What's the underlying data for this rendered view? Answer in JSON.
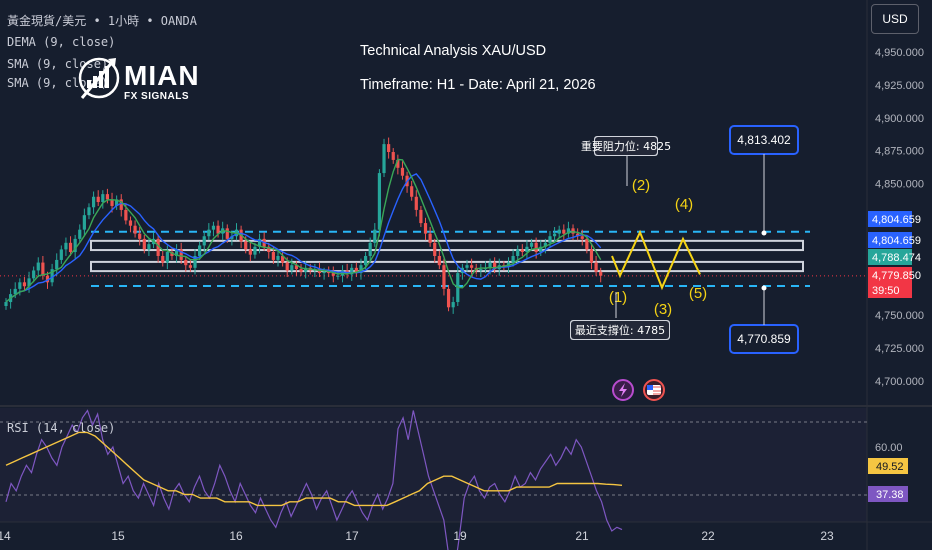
{
  "legend": {
    "symbol_line": "黃金現貨/美元 • 1小時 • OANDA",
    "indicator_1": "DEMA (9, close)",
    "indicator_2": "SMA (9, close)",
    "indicator_3": "SMA (9, close)",
    "rsi_label": "RSI (14, close)"
  },
  "logo": {
    "title": "MIAN",
    "subtitle": "FX SIGNALS"
  },
  "header": {
    "title": "Technical Analysis XAU/USD",
    "subtitle": "Timeframe: H1 - Date: April 21, 2026"
  },
  "price_axis": {
    "currency": "USD",
    "ticks": [
      "4,950.000",
      "4,925.000",
      "4,900.000",
      "4,875.000",
      "4,850.000",
      "4,750.000",
      "4,725.000",
      "4,700.000"
    ],
    "tick_values": [
      4950,
      4925,
      4900,
      4875,
      4850,
      4750,
      4725,
      4700
    ],
    "badges": [
      {
        "text": "4,804.659",
        "value": 4804.659,
        "color": "#2962ff"
      },
      {
        "text": "4,804.659",
        "value": 4804.659,
        "color": "#2962ff"
      },
      {
        "text": "4,788.474",
        "value": 4788.474,
        "color": "#26a69a"
      },
      {
        "text": "4,779.850",
        "value": 4779.85,
        "color": "#f23645"
      },
      {
        "text": "39:50",
        "value": null,
        "color": "#f23645"
      }
    ]
  },
  "rsi_axis": {
    "ticks": [
      "60.00"
    ],
    "badges": [
      {
        "text": "49.52",
        "value": 49.52,
        "color": "#f5c542"
      },
      {
        "text": "37.38",
        "value": 37.38,
        "color": "#7e57c2"
      }
    ]
  },
  "time_axis": {
    "labels": [
      "14",
      "15",
      "16",
      "17",
      "19",
      "21",
      "22",
      "23"
    ]
  },
  "annotations": {
    "resistance": {
      "text": "4,813.402",
      "value": 4813.402
    },
    "support": {
      "text": "4,770.859",
      "value": 4770.859
    },
    "resistance_note": "重要阻力位: 4825",
    "support_note": "最近支撐位: 4785",
    "wave_labels": [
      "(1)",
      "(2)",
      "(3)",
      "(4)",
      "(5)"
    ]
  },
  "colors": {
    "background": "#161e2e",
    "bull": "#26a69a",
    "bear": "#ef5350",
    "dema": "#3aa757",
    "sma_blue": "#2962ff",
    "wave": "#f5d315",
    "level_dash": "#29b6f6",
    "rsi": "#7e57c2",
    "rsi_ma": "#f5c542"
  },
  "chart_data": {
    "type": "candlestick",
    "title": "Technical Analysis XAU/USD",
    "subtitle": "Timeframe: H1 - Date: April 21, 2026",
    "xlabel": "",
    "ylabel": "",
    "ylim": [
      4690,
      4965
    ],
    "x_tick_labels": [
      "14",
      "15",
      "16",
      "17",
      "19",
      "21",
      "22",
      "23"
    ],
    "y_tick_labels": [
      "4,950.000",
      "4,925.000",
      "4,900.000",
      "4,875.000",
      "4,850.000",
      "4,750.000",
      "4,725.000",
      "4,700.000"
    ],
    "resistance_levels": [
      4813.402,
      4804.659
    ],
    "support_levels": [
      4788.474,
      4770.859
    ],
    "wave_projection": [
      {
        "label": "(1)",
        "price": 4780
      },
      {
        "label": "(2)",
        "price": 4813
      },
      {
        "label": "(3)",
        "price": 4771
      },
      {
        "label": "(4)",
        "price": 4808
      },
      {
        "label": "(5)",
        "price": 4781
      }
    ],
    "close_series": [
      4760,
      4766,
      4770,
      4775,
      4772,
      4778,
      4784,
      4790,
      4780,
      4775,
      4785,
      4792,
      4800,
      4805,
      4798,
      4808,
      4815,
      4826,
      4832,
      4840,
      4836,
      4842,
      4838,
      4833,
      4838,
      4830,
      4822,
      4818,
      4812,
      4808,
      4800,
      4804,
      4808,
      4795,
      4790,
      4798,
      4795,
      4800,
      4792,
      4788,
      4786,
      4795,
      4803,
      4810,
      4815,
      4818,
      4812,
      4816,
      4808,
      4810,
      4815,
      4806,
      4800,
      4796,
      4802,
      4808,
      4802,
      4798,
      4792,
      4795,
      4790,
      4784,
      4788,
      4785,
      4783,
      4786,
      4784,
      4785,
      4782,
      4783,
      4782,
      4780,
      4780,
      4784,
      4781,
      4786,
      4782,
      4788,
      4795,
      4805,
      4815,
      4858,
      4880,
      4874,
      4868,
      4862,
      4856,
      4848,
      4840,
      4830,
      4820,
      4812,
      4805,
      4795,
      4788,
      4770,
      4756,
      4760,
      4782,
      4786,
      4788,
      4786,
      4784,
      4785,
      4786,
      4790,
      4785,
      4788,
      4787,
      4790,
      4795,
      4800,
      4798,
      4802,
      4805,
      4798,
      4802,
      4805,
      4810,
      4812,
      4815,
      4812,
      4816,
      4812,
      4810,
      4808,
      4800,
      4790,
      4783,
      4780
    ],
    "rsi": {
      "ylim": [
        15,
        80
      ],
      "tick_labels": [
        "60.00"
      ],
      "rsi_values": [
        45,
        50,
        48,
        52,
        55,
        53,
        58,
        62,
        60,
        57,
        55,
        60,
        63,
        66,
        64,
        68,
        70,
        66,
        69,
        62,
        58,
        60,
        55,
        50,
        52,
        48,
        46,
        50,
        47,
        44,
        50,
        46,
        43,
        48,
        50,
        47,
        45,
        49,
        52,
        48,
        46,
        50,
        55,
        52,
        48,
        45,
        50,
        47,
        44,
        42,
        46,
        43,
        40,
        38,
        42,
        45,
        41,
        44,
        47,
        50,
        47,
        43,
        46,
        48,
        44,
        40,
        43,
        46,
        48,
        45,
        42,
        40,
        44,
        47,
        43,
        46,
        50,
        65,
        68,
        62,
        70,
        64,
        58,
        52,
        48,
        44,
        40,
        30,
        25,
        35,
        46,
        50,
        52,
        48,
        46,
        49,
        50,
        47,
        45,
        48,
        52,
        49,
        50,
        53,
        51,
        54,
        56,
        58,
        55,
        57,
        60,
        58,
        62,
        60,
        56,
        52,
        48,
        45,
        40,
        37,
        38,
        37.38
      ],
      "ma_values": [
        55,
        56,
        57,
        58,
        59,
        60,
        61,
        62,
        63,
        64,
        64,
        63,
        61,
        59,
        57,
        55,
        53,
        51,
        50,
        49,
        48,
        48,
        47,
        47,
        46,
        46,
        46,
        45,
        45,
        45,
        45,
        44,
        44,
        44,
        44,
        45,
        45,
        46,
        46,
        46,
        46,
        45,
        45,
        44,
        44,
        44,
        44,
        44,
        45,
        46,
        47,
        48,
        50,
        51,
        52,
        52,
        51,
        50,
        49,
        48,
        48,
        48,
        48,
        49,
        49,
        49,
        49,
        49,
        50,
        50,
        50,
        50,
        50,
        50,
        49.8,
        49.7,
        49.52
      ],
      "ma_last": 49.52,
      "rsi_last": 37.38
    }
  }
}
